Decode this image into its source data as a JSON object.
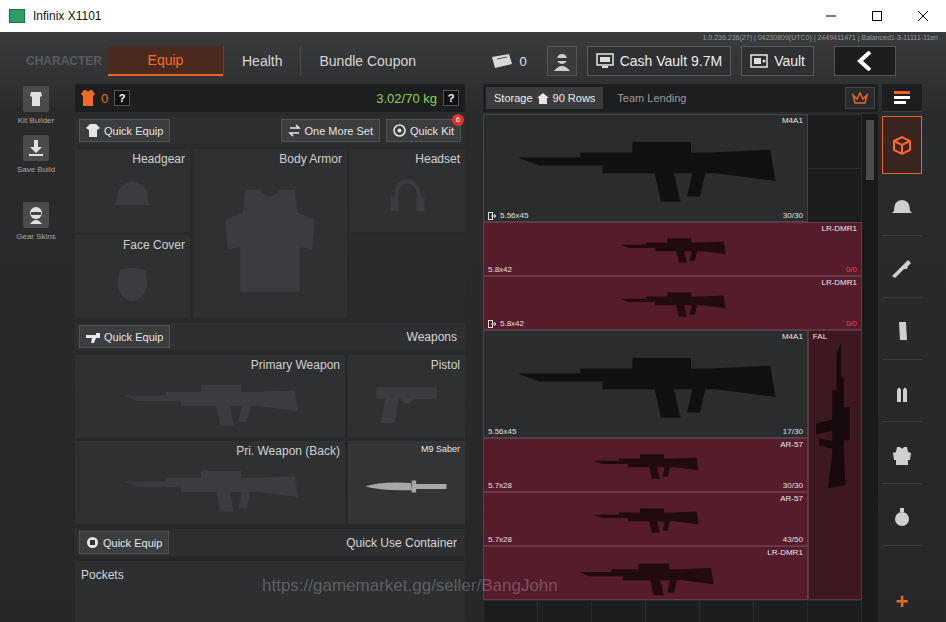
{
  "window": {
    "title": "Infinix X1101"
  },
  "build_info": "1.0.236.236(27) | 04230809(UTC0) | 2449411471 | Balanced1-3-11111-11en",
  "nav": {
    "section": "CHARACTER",
    "tabs": [
      {
        "label": "Equip",
        "selected": true
      },
      {
        "label": "Health",
        "selected": false
      },
      {
        "label": "Bundle Coupon",
        "selected": false
      }
    ],
    "tickets": "0",
    "cash_vault": "Cash Vault 9.7M",
    "vault": "Vault"
  },
  "sidebar": {
    "items": [
      {
        "label": "Kit Builder",
        "kind": "kit"
      },
      {
        "label": "Save Build",
        "kind": "save"
      },
      {
        "label": "Gear Skins",
        "kind": "skins"
      }
    ]
  },
  "loadout": {
    "armor_class": "0",
    "armor_help": "?",
    "weight": "3.02/70 kg",
    "weight_help": "?",
    "actions": [
      {
        "label": "Quick Equip",
        "kind": "shirt"
      },
      {
        "label": "One More Set",
        "kind": "swap"
      },
      {
        "label": "Quick Kit",
        "kind": "kit",
        "badge": "6"
      }
    ],
    "gear_slots": [
      {
        "label": "Headgear",
        "kind": "helmet",
        "filled": false
      },
      {
        "label": "Body Armor",
        "kind": "armor",
        "filled": false
      },
      {
        "label": "Headset",
        "kind": "headset",
        "filled": false
      },
      {
        "label": "Face Cover",
        "kind": "mask",
        "filled": false
      }
    ],
    "weapons": {
      "button": "Quick Equip",
      "title": "Weapons",
      "slots": [
        {
          "label": "Primary Weapon",
          "kind": "rifle",
          "filled": false
        },
        {
          "label": "Pistol",
          "kind": "pistol",
          "filled": false
        },
        {
          "label": "Pri. Weapon (Back)",
          "kind": "rifle",
          "filled": false
        },
        {
          "label": "M9 Saber",
          "kind": "knife",
          "filled": true
        }
      ]
    },
    "container": {
      "button": "Quick Equip",
      "title": "Quick Use Container"
    },
    "pockets": "Pockets"
  },
  "storage": {
    "tabs": [
      {
        "label": "Storage",
        "rows": "90 Rows",
        "selected": true
      },
      {
        "label": "Team Lending",
        "selected": false
      }
    ],
    "items": [
      {
        "name": "M4A1",
        "ammo": "5.56x45",
        "count": "30/30",
        "count_alert": false,
        "moved": true,
        "color": "#2b2c2d"
      },
      {
        "name": "LR-DMR1",
        "ammo": "5.8x42",
        "count": "0/0",
        "count_alert": true,
        "moved": false,
        "color": "#571c2b"
      },
      {
        "name": "LR-DMR1",
        "ammo": "5.8x42",
        "count": "0/0",
        "count_alert": true,
        "moved": true,
        "color": "#571c2b"
      },
      {
        "name": "M4A1",
        "ammo": "5.56x45",
        "count": "17/30",
        "count_alert": false,
        "moved": false,
        "color": "#2b2c2d"
      },
      {
        "name": "FAL",
        "moved": false,
        "color": "#3e1820"
      },
      {
        "name": "AR-57",
        "ammo": "5.7x28",
        "count": "30/30",
        "count_alert": false,
        "moved": false,
        "color": "#571c2b"
      },
      {
        "name": "AR-57",
        "ammo": "5.7x28",
        "count": "43/50",
        "count_alert": false,
        "moved": false,
        "color": "#571c2b"
      },
      {
        "name": "LR-DMR1",
        "moved": false,
        "color": "#571c2b"
      }
    ]
  },
  "categories": {
    "items": [
      {
        "kind": "sort",
        "selected": false
      },
      {
        "kind": "all",
        "selected": true
      },
      {
        "kind": "helmet",
        "selected": false
      },
      {
        "kind": "rifle",
        "selected": false
      },
      {
        "kind": "magazine",
        "selected": false
      },
      {
        "kind": "ammo",
        "selected": false
      },
      {
        "kind": "armor",
        "selected": false
      },
      {
        "kind": "grenade",
        "selected": false
      }
    ],
    "add": "+"
  },
  "watermark": "https://gamemarket.gg/seller/BangJohn"
}
